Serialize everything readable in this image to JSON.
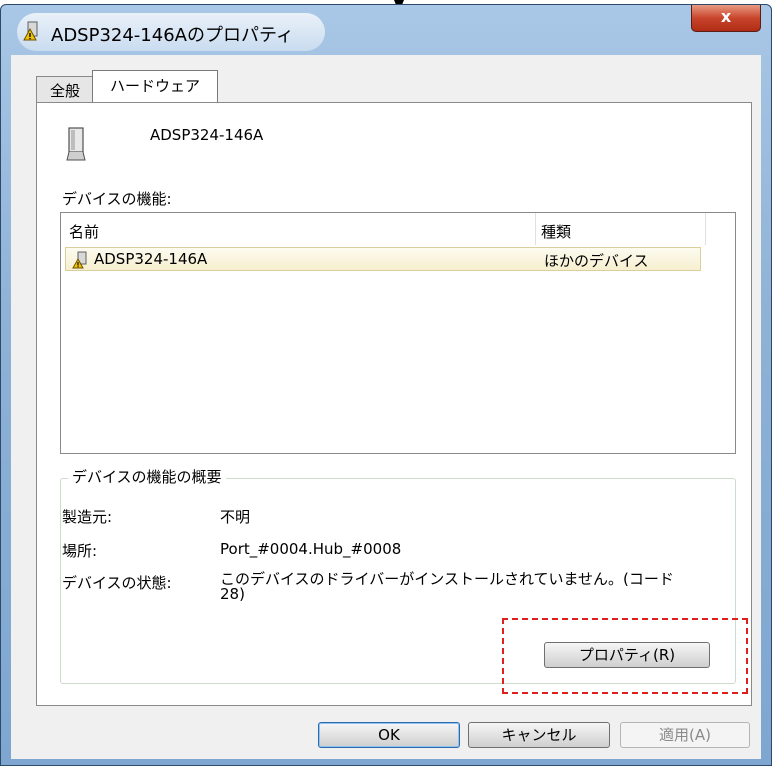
{
  "window": {
    "title": "ADSP324-146Aのプロパティ",
    "close_label": "x"
  },
  "tabs": [
    {
      "label": "全般",
      "active": false
    },
    {
      "label": "ハードウェア",
      "active": true
    }
  ],
  "device": {
    "name": "ADSP324-146A"
  },
  "functions": {
    "label": "デバイスの機能:",
    "columns": {
      "name": "名前",
      "type": "種類"
    },
    "rows": [
      {
        "name": "ADSP324-146A",
        "type": "ほかのデバイス",
        "icon": "warning-device-icon"
      }
    ]
  },
  "summary": {
    "title": "デバイスの機能の概要",
    "manufacturer_label": "製造元:",
    "manufacturer_value": "不明",
    "location_label": "場所:",
    "location_value": "Port_#0004.Hub_#0008",
    "status_label": "デバイスの状態:",
    "status_value_line1": "このデバイスのドライバーがインストールされていません。(コード",
    "status_value_line2": "28)",
    "properties_button": "プロパティ(R)"
  },
  "buttons": {
    "ok": "OK",
    "cancel": "キャンセル",
    "apply": "適用(A)"
  },
  "colors": {
    "highlight_dashed": "#e02020",
    "row_selected": "#f6efcf",
    "titlebar": "#a9c7e6",
    "close_button": "#c8452c"
  }
}
